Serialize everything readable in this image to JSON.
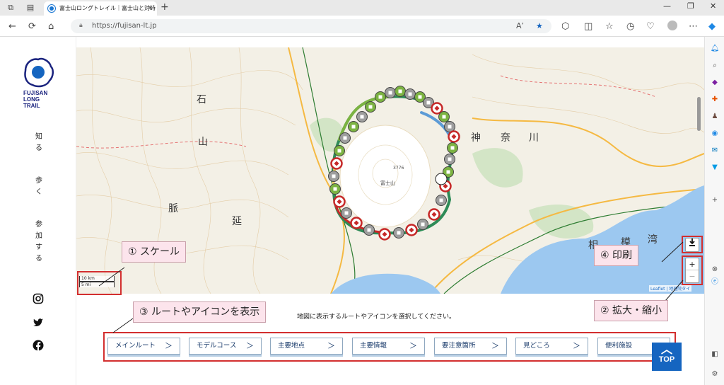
{
  "browser": {
    "tab_title": "富士山ロングトレイル｜富士山と対峙",
    "url": "https://fujisan-lt.jp",
    "new_tab": "+",
    "reader_label": "Aʼ"
  },
  "site": {
    "logo_lines": [
      "FUJISAN",
      "LONG",
      "TRAIL"
    ],
    "nav": [
      {
        "chars": [
          "知",
          "る"
        ]
      },
      {
        "chars": [
          "歩",
          "く"
        ]
      },
      {
        "chars": [
          "参",
          "加",
          "す",
          "る"
        ]
      }
    ],
    "social": [
      "instagram-icon",
      "twitter-icon",
      "facebook-icon"
    ]
  },
  "map": {
    "scale_km": "10 km",
    "scale_mi": "5 mi",
    "zoom_in": "+",
    "zoom_out": "−",
    "download_icon": "download-icon",
    "attribution": "Leaflet | 地理院タイ",
    "summit_label": "富士山",
    "summit_height": "3776",
    "kanji_labels": [
      "神",
      "奈",
      "川",
      "相",
      "模",
      "湾",
      "石",
      "山",
      "脈",
      "延"
    ]
  },
  "annotations": {
    "scale": "① スケール",
    "route_icons": "③ ルートやアイコンを表示",
    "zoom": "② 拡大・縮小",
    "print": "④ 印刷"
  },
  "selection": {
    "instruction": "地図に表示するルートやアイコンを選択してください。",
    "buttons": [
      "メインルート",
      "モデルコース",
      "主要地点",
      "主要情報",
      "要注意箇所",
      "見どころ",
      "便利施設"
    ],
    "arrow": "＞"
  },
  "top_button": "TOP",
  "colors": {
    "annotation_red": "#d32f2f",
    "callout_pink": "#fce4ec",
    "brand_blue": "#1565c0",
    "route_green": "#2e8b57",
    "route_red": "#c62828",
    "sea_blue": "#9cc8f0"
  }
}
